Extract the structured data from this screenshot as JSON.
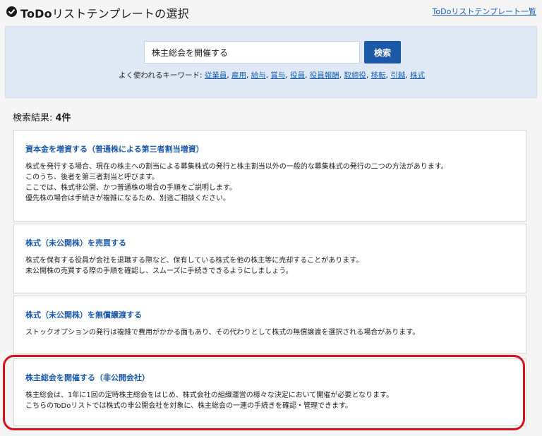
{
  "header": {
    "title_prefix": "ToDo",
    "title_rest": "リストテンプレートの選択",
    "list_link": "ToDoリストテンプレート一覧"
  },
  "search": {
    "value": "株主総会を開催する",
    "button_label": "検索",
    "keywords_label": "よく使われるキーワード: ",
    "keywords": [
      "従業員",
      "雇用",
      "給与",
      "賞与",
      "役員",
      "役員報酬",
      "取締役",
      "移転",
      "引越",
      "株式"
    ]
  },
  "results": {
    "label": "検索結果: ",
    "count": "4件",
    "items": [
      {
        "title": "資本金を増資する（普通株による第三者割当増資）",
        "lines": [
          "株式を発行する場合、現在の株主への割当による募集株式の発行と株主割当以外の一般的な募集株式の発行の二つの方法があります。",
          "このうち、後者を第三者割当と呼びます。",
          "ここでは、株式非公開、かつ普通株の場合の手順をご説明します。",
          "優先株の場合は手続きが複雑になるため、別途ご相談ください。"
        ]
      },
      {
        "title": "株式（未公開株）を売買する",
        "lines": [
          "株式を保有する役員が会社を退職する際など、保有している株式を他の株主等に売却することがあります。",
          "未公開株の売買する際の手順を確認し、スムーズに手続きできるようにしましょう。"
        ]
      },
      {
        "title": "株式（未公開株）を無償譲渡する",
        "lines": [
          "ストックオプションの発行は複雑で費用がかかる面もあり、その代わりとして株式の無償譲渡を選択される場合があります。"
        ]
      },
      {
        "title": "株主総会を開催する（非公開会社）",
        "lines": [
          "株主総会は、1年に1回の定時株主総会をはじめ、株式会社の組織運営の様々な決定において開催が必要となります。",
          "こちらのToDoリストでは株式の非公開会社を対象に、株主総会の一連の手続きを確認・管理できます。"
        ]
      }
    ]
  },
  "colors": {
    "accent": "#1c5aa8",
    "link": "#1a5fb4",
    "highlight": "#d8101e",
    "panel": "#dfe9f5"
  }
}
